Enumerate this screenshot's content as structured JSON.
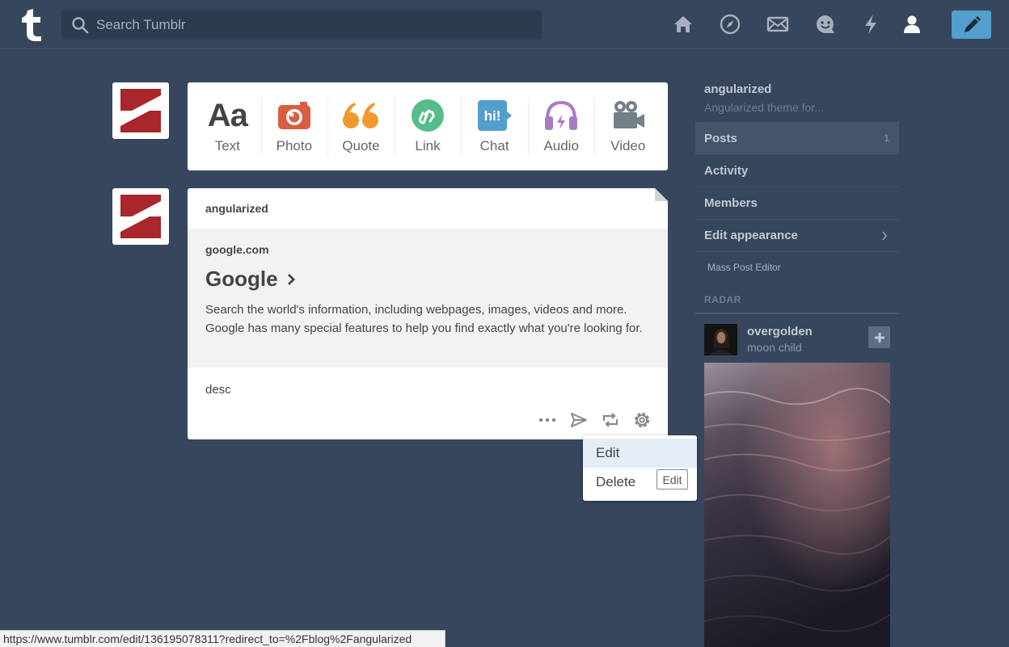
{
  "search": {
    "placeholder": "Search Tumblr"
  },
  "nav": [
    "home-icon",
    "explore-icon",
    "inbox-icon",
    "messaging-icon",
    "activity-icon",
    "account-icon"
  ],
  "post_types": [
    {
      "label": "Text",
      "icon": "text-icon",
      "color": "#444444"
    },
    {
      "label": "Photo",
      "icon": "camera-icon",
      "color": "#d95e40"
    },
    {
      "label": "Quote",
      "icon": "quote-icon",
      "color": "#f2992e"
    },
    {
      "label": "Link",
      "icon": "link-icon",
      "color": "#56bc8a"
    },
    {
      "label": "Chat",
      "icon": "chat-icon",
      "color": "#529ecc"
    },
    {
      "label": "Audio",
      "icon": "headphones-icon",
      "color": "#a77dc2"
    },
    {
      "label": "Video",
      "icon": "video-camera-icon",
      "color": "#748089"
    }
  ],
  "post": {
    "blog_name": "angularized",
    "link": {
      "host": "google.com",
      "title": "Google",
      "description": "Search the world's information, including webpages, images, videos and more. Google has many special features to help you find exactly what you're looking for."
    },
    "caption": "desc",
    "controls": [
      "more-icon",
      "share-icon",
      "reblog-icon",
      "settings-gear-icon"
    ]
  },
  "dropdown": {
    "items": [
      "Edit",
      "Delete"
    ],
    "tooltip": "Edit"
  },
  "sidebar": {
    "blog_title": "angularized",
    "blog_subtitle": "Angularized theme for...",
    "items": [
      {
        "label": "Posts",
        "count": "1"
      },
      {
        "label": "Activity"
      },
      {
        "label": "Members"
      },
      {
        "label": "Edit appearance"
      }
    ],
    "mass_editor": "Mass Post Editor",
    "radar": {
      "heading": "RADAR",
      "blog_name": "overgolden",
      "blog_subtitle": "moon child"
    }
  },
  "status_bar": "https://www.tumblr.com/edit/136195078311?redirect_to=%2Fblog%2Fangularized",
  "colors": {
    "background": "#36465d",
    "compose": "#529ecc",
    "logo_red": "#a8262c"
  }
}
